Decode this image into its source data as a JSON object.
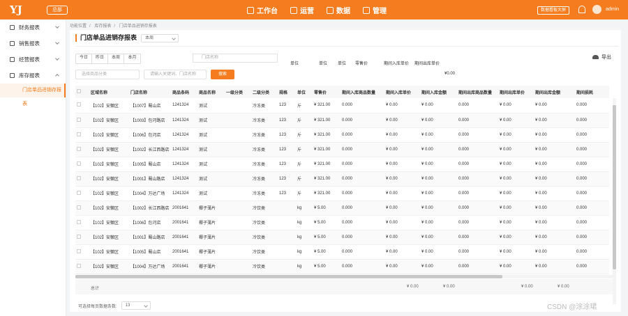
{
  "topbar": {
    "logo": "YJ",
    "org": "总部",
    "nav": [
      "工作台",
      "运营",
      "数据",
      "管理"
    ],
    "nav_icons": [
      "monitor-icon",
      "cart-icon",
      "bar-chart-icon",
      "grid-icon"
    ],
    "bigscreen": "数据看板大屏",
    "user": "admin"
  },
  "sidebar": {
    "items": [
      {
        "label": "财务报表",
        "icon": "target-icon"
      },
      {
        "label": "销售报表",
        "icon": "doc-icon"
      },
      {
        "label": "经营报表",
        "icon": "calendar-icon"
      },
      {
        "label": "库存报表",
        "icon": "box-icon"
      }
    ],
    "sub": "门店单品进销存报表"
  },
  "breadcrumb": [
    "功能位置",
    "库存报表",
    "门店单品进销存报表"
  ],
  "page": {
    "title": "门店单品进销存报表",
    "period": "本周",
    "export": "导出",
    "date_tabs": [
      "今日",
      "昨日",
      "本周",
      "本月"
    ],
    "store_placeholder": "门店名称",
    "cat_placeholder": "选择商品分类",
    "kw_placeholder": "请输入关键词、门店名称",
    "search": "搜索"
  },
  "ghost": {
    "r1": [
      "单位",
      "单位",
      "单位",
      "零售价",
      "期间入库单价",
      "期间出库单价"
    ],
    "amount": "¥0.00"
  },
  "table": {
    "columns": [
      "区域名称",
      "门店名称",
      "商品条码",
      "商品名称",
      "一级分类",
      "二级分类",
      "规格",
      "单位",
      "零售价",
      "期间入库商品数量",
      "期间入库单价",
      "期间入库金额",
      "期间出库商品数量",
      "期间出库单价",
      "期间出库金额",
      "期间损耗"
    ],
    "rows": [
      [
        "【102】安徽区",
        "【1007】蜀山店",
        "1241324",
        "测试",
        "",
        "冷冻类",
        "123",
        "斤",
        "¥ 321.00",
        "0.000",
        "¥ 0.00",
        "¥ 0.00",
        "0.000",
        "¥ 0.00",
        "¥ 0.00",
        "0.000"
      ],
      [
        "【102】安徽区",
        "【1003】包河路店",
        "1241324",
        "测试",
        "",
        "冷冻类",
        "123",
        "斤",
        "¥ 321.00",
        "0.000",
        "¥ 0.00",
        "¥ 0.00",
        "0.000",
        "¥ 0.00",
        "¥ 0.00",
        "0.000"
      ],
      [
        "【102】安徽区",
        "【1006】包河店",
        "1241324",
        "测试",
        "",
        "冷冻类",
        "123",
        "斤",
        "¥ 321.00",
        "0.000",
        "¥ 0.00",
        "¥ 0.00",
        "0.000",
        "¥ 0.00",
        "¥ 0.00",
        "0.000"
      ],
      [
        "【102】安徽区",
        "【1002】长江西路店",
        "1241324",
        "测试",
        "",
        "冷冻类",
        "123",
        "斤",
        "¥ 321.00",
        "0.000",
        "¥ 0.00",
        "¥ 0.00",
        "0.000",
        "¥ 0.00",
        "¥ 0.00",
        "0.000"
      ],
      [
        "【102】安徽区",
        "【1005】蜀山店",
        "1241324",
        "测试",
        "",
        "冷冻类",
        "123",
        "斤",
        "¥ 321.00",
        "0.000",
        "¥ 0.00",
        "¥ 0.00",
        "0.000",
        "¥ 0.00",
        "¥ 0.00",
        "0.000"
      ],
      [
        "【102】安徽区",
        "【1001】蜀山路店",
        "1241324",
        "测试",
        "",
        "冷冻类",
        "123",
        "斤",
        "¥ 321.00",
        "0.000",
        "¥ 0.00",
        "¥ 0.00",
        "0.000",
        "¥ 0.00",
        "¥ 0.00",
        "0.000"
      ],
      [
        "【102】安徽区",
        "【1004】万达广场",
        "1241324",
        "测试",
        "",
        "冷冻类",
        "123",
        "斤",
        "¥ 321.00",
        "0.000",
        "¥ 0.00",
        "¥ 0.00",
        "0.000",
        "¥ 0.00",
        "¥ 0.00",
        "0.000"
      ],
      [
        "【102】安徽区",
        "【1002】长江西路店",
        "2001641",
        "椰子薄片",
        "",
        "冷饮类",
        "",
        "kg",
        "¥ 5.00",
        "0.000",
        "¥ 0.00",
        "¥ 0.00",
        "0.000",
        "¥ 0.00",
        "¥ 0.00",
        "0.000"
      ],
      [
        "【102】安徽区",
        "【1006】包河店",
        "2001641",
        "椰子薄片",
        "",
        "冷饮类",
        "",
        "kg",
        "¥ 5.00",
        "0.000",
        "¥ 0.00",
        "¥ 0.00",
        "0.000",
        "¥ 0.00",
        "¥ 0.00",
        "0.000"
      ],
      [
        "【102】安徽区",
        "【1001】蜀山路店",
        "2001641",
        "椰子薄片",
        "",
        "冷饮类",
        "",
        "kg",
        "¥ 5.00",
        "0.000",
        "¥ 0.00",
        "¥ 0.00",
        "0.000",
        "¥ 0.00",
        "¥ 0.00",
        "0.000"
      ],
      [
        "【102】安徽区",
        "【1005】蜀山店",
        "2001641",
        "椰子薄片",
        "",
        "冷饮类",
        "",
        "kg",
        "¥ 5.00",
        "0.000",
        "¥ 0.00",
        "¥ 0.00",
        "0.000",
        "¥ 0.00",
        "¥ 0.00",
        "0.000"
      ],
      [
        "【102】安徽区",
        "【1004】万达广场",
        "2001641",
        "椰子薄片",
        "",
        "冷饮类",
        "",
        "kg",
        "¥ 5.00",
        "0.000",
        "¥ 0.00",
        "¥ 0.00",
        "0.000",
        "¥ 0.00",
        "¥ 0.00",
        "0.000"
      ]
    ],
    "total_label": "总计",
    "total_values": [
      "¥ 0.00",
      "¥ 0.00",
      "¥ 0.00",
      "¥ 0.00"
    ]
  },
  "pager": {
    "label": "可选择每页数据条数:",
    "size": "13"
  },
  "watermark": "CSDN @涂涂珺"
}
